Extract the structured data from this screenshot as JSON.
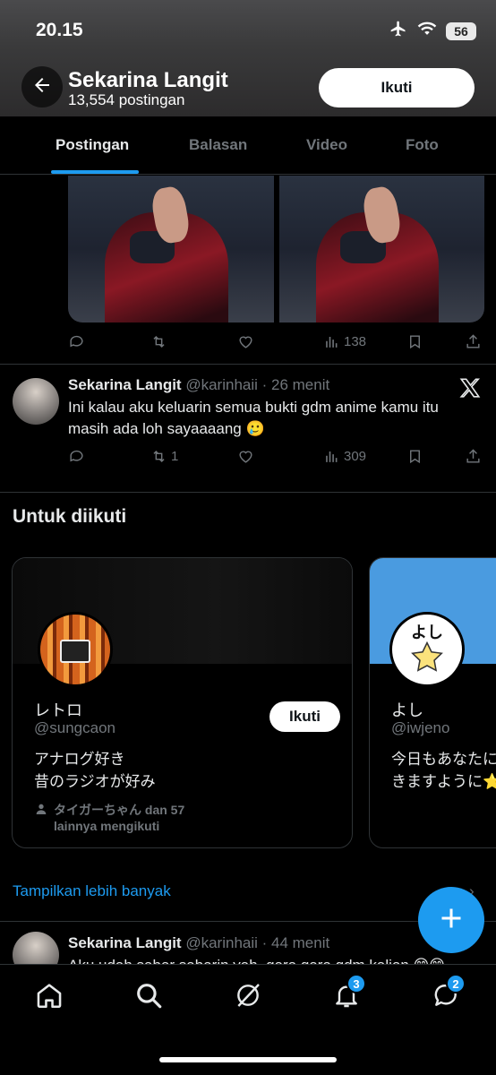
{
  "status_bar": {
    "time": "20.15",
    "battery": "56"
  },
  "header": {
    "name": "Sekarina Langit",
    "post_count": "13,554 postingan",
    "follow_label": "Ikuti"
  },
  "tabs": [
    {
      "label": "Postingan",
      "active": true
    },
    {
      "label": "Balasan",
      "active": false
    },
    {
      "label": "Video",
      "active": false
    },
    {
      "label": "Foto",
      "active": false
    }
  ],
  "tweet1": {
    "views": "138"
  },
  "tweet2": {
    "name": "Sekarina Langit",
    "handle_time": "@karinhaii · 26 menit",
    "text": "Ini kalau aku keluarin semua bukti gdm anime kamu itu masih ada loh sayaaaang 🥲",
    "retweets": "1",
    "views": "309"
  },
  "who_to_follow": {
    "title": "Untuk diikuti",
    "cards": [
      {
        "name": "レトロ",
        "handle": "@sungcaon",
        "bio": "アナログ好き\n昔のラジオが好み",
        "follow_label": "Ikuti",
        "mutual": "タイガーちゃん dan 57\nlainnya mengikuti"
      },
      {
        "name": "よし",
        "handle": "@iwjeno",
        "bio": "今日もあなたに\nきますように⭐",
        "avatar_text": "よし"
      }
    ],
    "show_more": "Tampilkan lebih banyak"
  },
  "tweet3": {
    "name": "Sekarina Langit",
    "handle_time": "@karinhaii · 44 menit",
    "text": "Aku udah sabar sabarin yah, gara gara gdm kalian 😊😊"
  },
  "nav": {
    "notifications_badge": "3",
    "messages_badge": "2"
  },
  "colors": {
    "accent": "#1d9bf0",
    "muted": "#71767b",
    "text": "#e7e9ea",
    "divider": "#2f3336"
  }
}
